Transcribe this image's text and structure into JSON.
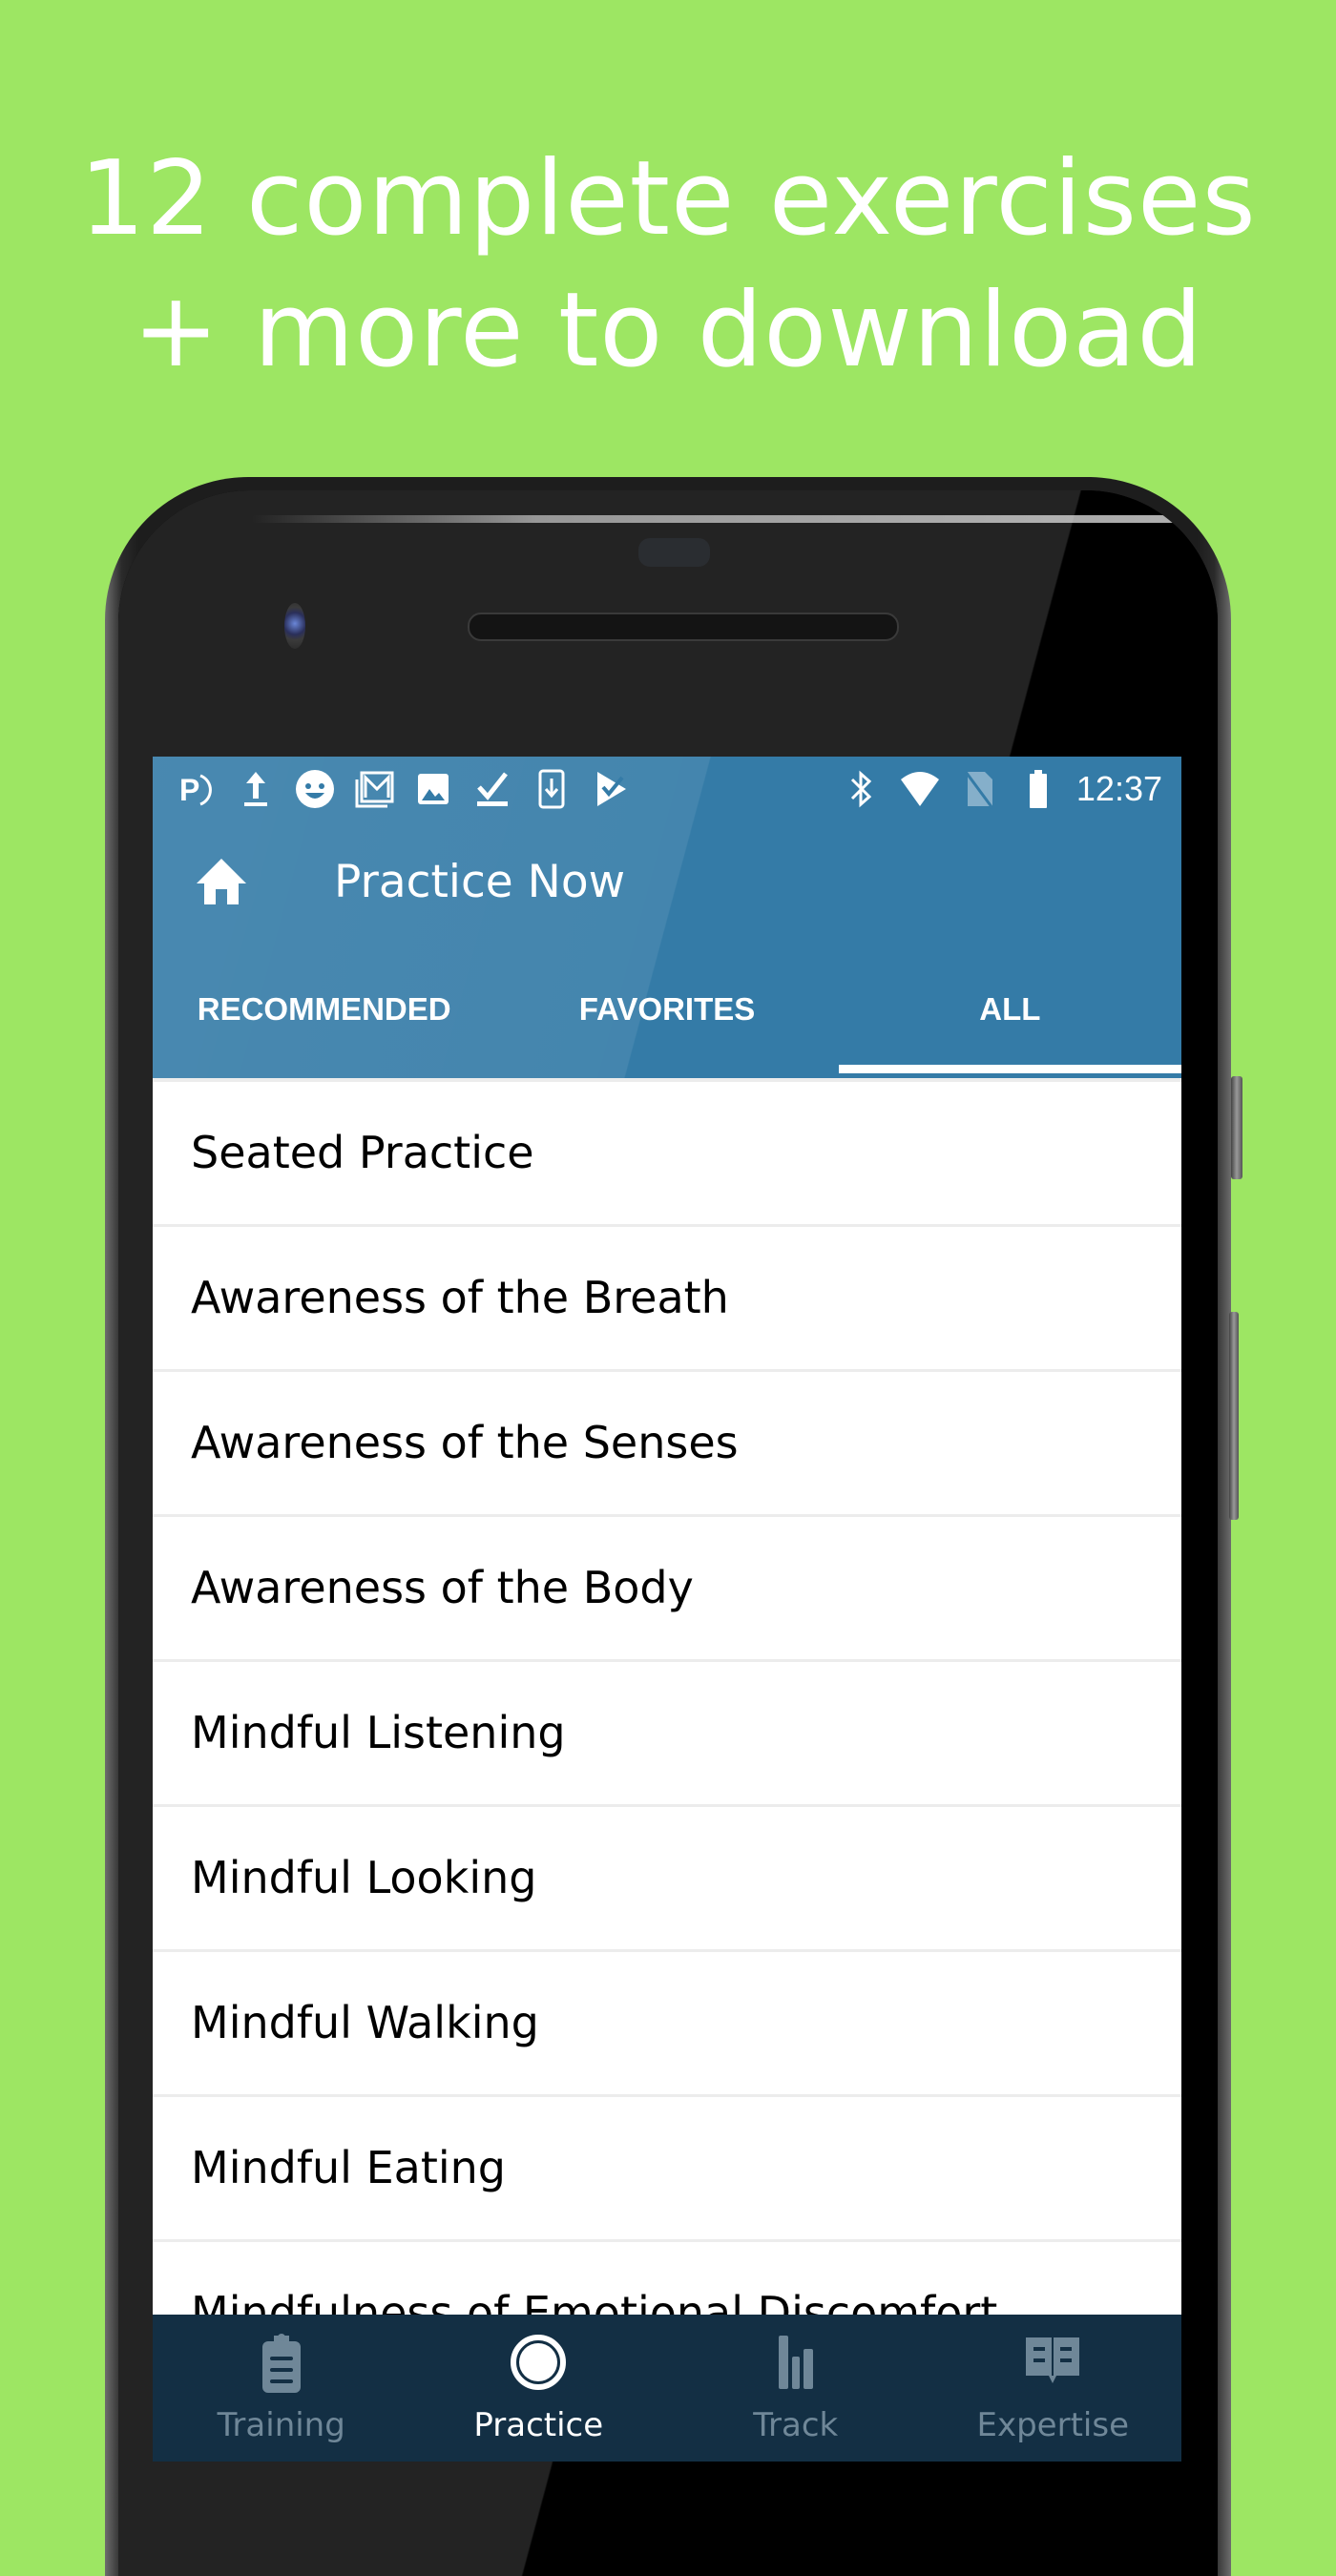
{
  "headline": {
    "line1": "12 complete exercises",
    "line2": "+ more to download"
  },
  "colors": {
    "background": "#9de663",
    "appbar": "#347ba7",
    "bottom_nav": "#132f44",
    "nav_inactive": "#6f8798",
    "nav_active": "#ffffff"
  },
  "status_bar": {
    "left_icons": [
      "pocket-casts-icon",
      "upload-icon",
      "smiley-app-icon",
      "gmail-icon",
      "image-icon",
      "checkmark-icon",
      "download-phone-icon",
      "tasks-icon"
    ],
    "right_icons": [
      "bluetooth-icon",
      "wifi-icon",
      "no-sim-icon",
      "battery-icon"
    ],
    "time": "12:37"
  },
  "toolbar": {
    "home_icon": "home-icon",
    "title": "Practice Now"
  },
  "tabs": [
    {
      "label": "RECOMMENDED",
      "active": false
    },
    {
      "label": "FAVORITES",
      "active": false
    },
    {
      "label": "ALL",
      "active": true
    }
  ],
  "exercises": [
    "Seated Practice",
    "Awareness of the Breath",
    "Awareness of the Senses",
    "Awareness of the Body",
    "Mindful Listening",
    "Mindful Looking",
    "Mindful Walking",
    "Mindful Eating",
    "Mindfulness of Emotional Discomfort"
  ],
  "bottom_nav": [
    {
      "label": "Training",
      "icon": "clipboard-icon",
      "active": false
    },
    {
      "label": "Practice",
      "icon": "circle-icon",
      "active": true
    },
    {
      "label": "Track",
      "icon": "bar-chart-icon",
      "active": false
    },
    {
      "label": "Expertise",
      "icon": "book-icon",
      "active": false
    }
  ]
}
